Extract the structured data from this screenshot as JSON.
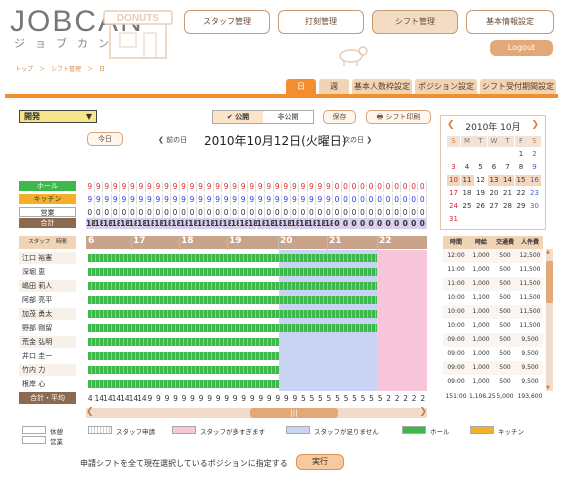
{
  "logo": {
    "main": "JOBCAN",
    "sub": "ジョブカン",
    "deco": "DONUTS"
  },
  "nav": {
    "staff": "スタッフ管理",
    "attendance": "打刻管理",
    "shift": "シフト管理",
    "info": "基本情報設定",
    "logout": "Logout"
  },
  "breadcrumb": "トップ　＞　シフト管理　＞　日",
  "tabs": [
    "日",
    "週",
    "基本人数枠設定",
    "ポジション設定",
    "シフト受付期間設定"
  ],
  "toolbar": {
    "position": "開発",
    "public": "公開",
    "private": "非公開",
    "save": "保存",
    "print": "シフト印刷",
    "today": "今日",
    "prev": "前の日",
    "next": "次の日",
    "date": "2010年10月12日(火曜日)"
  },
  "rows": {
    "hall": "ホール",
    "kitchen": "キッチン",
    "business": "営業",
    "total": "合計",
    "staff_header": "スタッフ　時間",
    "sum_avg": "合計・平均"
  },
  "counts": {
    "hall": [
      "9",
      "9",
      "9",
      "9",
      "9",
      "9",
      "9",
      "9",
      "9",
      "9",
      "9",
      "9",
      "9",
      "9",
      "9",
      "9",
      "9",
      "9",
      "9",
      "9",
      "9",
      "9",
      "9",
      "9",
      "9",
      "9",
      "9",
      "9",
      "9",
      "0",
      "0",
      "0",
      "0",
      "0",
      "0",
      "0",
      "0",
      "0",
      "0",
      "0"
    ],
    "kitchen": [
      "9",
      "9",
      "9",
      "9",
      "9",
      "9",
      "9",
      "9",
      "9",
      "9",
      "9",
      "9",
      "9",
      "9",
      "9",
      "9",
      "9",
      "9",
      "9",
      "9",
      "9",
      "9",
      "9",
      "9",
      "9",
      "9",
      "9",
      "9",
      "9",
      "0",
      "0",
      "0",
      "0",
      "0",
      "0",
      "0",
      "0",
      "0",
      "0",
      "0"
    ],
    "business": [
      "0",
      "0",
      "0",
      "0",
      "0",
      "0",
      "0",
      "0",
      "0",
      "0",
      "0",
      "0",
      "0",
      "0",
      "0",
      "0",
      "0",
      "0",
      "0",
      "0",
      "0",
      "0",
      "0",
      "0",
      "0",
      "0",
      "0",
      "0",
      "0",
      "0",
      "0",
      "0",
      "0",
      "0",
      "0",
      "0",
      "0",
      "0",
      "0",
      "0"
    ],
    "total": [
      "18",
      "18",
      "18",
      "18",
      "18",
      "18",
      "18",
      "18",
      "18",
      "18",
      "18",
      "18",
      "18",
      "18",
      "18",
      "18",
      "18",
      "18",
      "18",
      "18",
      "18",
      "18",
      "18",
      "18",
      "18",
      "18",
      "18",
      "18",
      "18",
      "0",
      "0",
      "0",
      "0",
      "0",
      "0",
      "0",
      "0",
      "0",
      "0",
      "0"
    ]
  },
  "hours": [
    "6",
    "17",
    "18",
    "19",
    "20",
    "21",
    "22"
  ],
  "staff": [
    {
      "name": "江口 裕憲",
      "end": 0.853
    },
    {
      "name": "深堀 恵",
      "end": 0.853
    },
    {
      "name": "嶋田 莉人",
      "end": 0.853
    },
    {
      "name": "阿部 亮平",
      "end": 0.853
    },
    {
      "name": "加茂 勇太",
      "end": 0.853
    },
    {
      "name": "野部 剛留",
      "end": 0.853
    },
    {
      "name": "荒金 弘明",
      "end": 0.565
    },
    {
      "name": "井口 圭一",
      "end": 0.565
    },
    {
      "name": "竹内 力",
      "end": 0.565
    },
    {
      "name": "根岸 心",
      "end": 0.565
    }
  ],
  "footer_counts": [
    "4",
    "14",
    "14",
    "14",
    "14",
    "14",
    "14",
    "9",
    "9",
    "9",
    "9",
    "9",
    "9",
    "9",
    "9",
    "9",
    "9",
    "9",
    "9",
    "9",
    "9",
    "9",
    "9",
    "9",
    "9",
    "5",
    "5",
    "5",
    "5",
    "5",
    "5",
    "5",
    "5",
    "5",
    "5",
    "2",
    "2",
    "2",
    "2",
    "2"
  ],
  "calendar": {
    "title": "2010年 10月",
    "days": [
      "S",
      "M",
      "T",
      "W",
      "T",
      "F",
      "S"
    ],
    "weeks": [
      [
        "",
        "",
        "",
        "",
        "",
        "1",
        "2"
      ],
      [
        "3",
        "4",
        "5",
        "6",
        "7",
        "8",
        "9"
      ],
      [
        "10",
        "11",
        "12",
        "13",
        "14",
        "15",
        "16"
      ],
      [
        "17",
        "18",
        "19",
        "20",
        "21",
        "22",
        "23"
      ],
      [
        "24",
        "25",
        "26",
        "27",
        "28",
        "29",
        "30"
      ],
      [
        "31",
        "",
        "",
        "",
        "",
        "",
        ""
      ]
    ]
  },
  "stats": {
    "headers": [
      "時間",
      "時給",
      "交通費",
      "人件費"
    ],
    "rows": [
      [
        "12:00",
        "1,000",
        "500",
        "12,500"
      ],
      [
        "11:00",
        "1,000",
        "500",
        "11,500"
      ],
      [
        "11:00",
        "1,000",
        "500",
        "11,500"
      ],
      [
        "10:00",
        "1,100",
        "500",
        "11,500"
      ],
      [
        "10:00",
        "1,000",
        "500",
        "11,500"
      ],
      [
        "10:00",
        "1,000",
        "500",
        "11,500"
      ],
      [
        "09:00",
        "1,000",
        "500",
        "9,500"
      ],
      [
        "09:00",
        "1,000",
        "500",
        "9,500"
      ],
      [
        "09:00",
        "1,000",
        "500",
        "9,500"
      ],
      [
        "09:00",
        "1,000",
        "500",
        "9,500"
      ]
    ],
    "total": [
      "151:00",
      "1,106.25",
      "5,000",
      "193,600"
    ]
  },
  "legend": {
    "break": "休憩",
    "applied": "スタッフ申請",
    "over": "スタッフが多すぎます",
    "under": "スタッフが足りません",
    "hall": "ホール",
    "kitchen": "キッチン",
    "business": "営業"
  },
  "footer": {
    "text": "申請シフトを全て現在選択しているポジションに指定する",
    "exec": "実行"
  },
  "colors": {
    "accent": "#f28e2d",
    "hall": "#3cb94a",
    "kitchen": "#f5b02a",
    "over": "#f7c6da",
    "under": "#c9d3f3"
  }
}
